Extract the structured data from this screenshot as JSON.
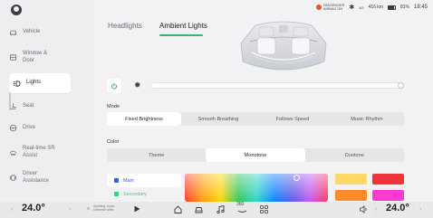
{
  "sidebar": {
    "items": [
      {
        "icon": "car-icon",
        "label": "Vehicle"
      },
      {
        "icon": "window-icon",
        "label": "Window &\nDoor"
      },
      {
        "icon": "lights-icon",
        "label": "Lights",
        "active": true
      },
      {
        "icon": "seat-icon",
        "label": "Seat"
      },
      {
        "icon": "steering-icon",
        "label": "Drive"
      },
      {
        "icon": "sr-icon",
        "label": "Real-time SR\nAssist"
      },
      {
        "icon": "driver-assist-icon",
        "label": "Driver\nAssistance"
      }
    ]
  },
  "status_bar": {
    "airbag_line1": "PASSENGER",
    "airbag_line2": "AIRBAG ON",
    "signal": "4G",
    "range": "416 km",
    "battery": "81%",
    "time": "18:45"
  },
  "tabs": [
    {
      "label": "Headlights",
      "active": false
    },
    {
      "label": "Ambient Lights",
      "active": true
    }
  ],
  "brightness": {
    "level": 1.0
  },
  "mode": {
    "label": "Mode",
    "options": [
      "Fixed Brightness",
      "Smooth Breathing",
      "Follows Speed",
      "Music Rhythm"
    ],
    "selected": "Fixed Brightness"
  },
  "color": {
    "label": "Color",
    "options": [
      "Theme",
      "Monotone",
      "Duotone"
    ],
    "selected": "Monotone",
    "list": [
      {
        "label": "Main",
        "color": "#2f62e6",
        "active": true
      },
      {
        "label": "Secondary",
        "color": "#3ccf7a",
        "active": false
      }
    ],
    "swatches": [
      "#ffd966",
      "#f0353a",
      "#ff8c2a",
      "#ff3ad0"
    ]
  },
  "dock": {
    "left_temp": "24.0°",
    "right_temp": "24.0°",
    "media_line1": "Anything, Anyw...",
    "media_line2": "Unknown artist",
    "center_label": "360"
  },
  "accent": "#3bb36c"
}
